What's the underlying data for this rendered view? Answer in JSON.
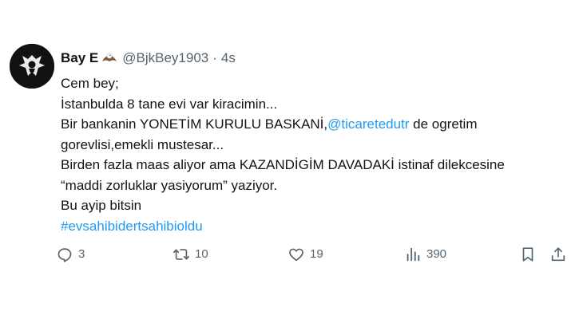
{
  "author": {
    "display_name": "Bay E",
    "badge_icon": "eagle-emoji-icon",
    "handle": "@BjkBey1903",
    "separator": "·",
    "time": "4s"
  },
  "tweet": {
    "lines": [
      [
        {
          "text": "Cem bey;"
        }
      ],
      [
        {
          "text": "İstanbulda 8 tane evi var kiracimin..."
        }
      ],
      [
        {
          "text": "Bir bankanin YONETİM KURULU BASKANİ,"
        },
        {
          "text": "@ticaretedutr",
          "type": "mention"
        },
        {
          "text": " de ogretim"
        }
      ],
      [
        {
          "text": "gorevlisi,emekli mustesar..."
        }
      ],
      [
        {
          "text": "Birden fazla maas aliyor ama KAZANDİGİM DAVADAKİ istinaf dilekcesine"
        }
      ],
      [
        {
          "text": "“maddi zorluklar yasiyorum” yaziyor."
        }
      ],
      [
        {
          "text": "Bu ayip bitsin"
        }
      ],
      [
        {
          "text": "#evsahibidertsahibioldu",
          "type": "hashtag"
        }
      ]
    ]
  },
  "actions": {
    "reply_count": "3",
    "retweet_count": "10",
    "like_count": "19",
    "view_count": "390"
  },
  "colors": {
    "link": "#1d9bf0",
    "muted": "#536471",
    "text": "#0f1419"
  }
}
